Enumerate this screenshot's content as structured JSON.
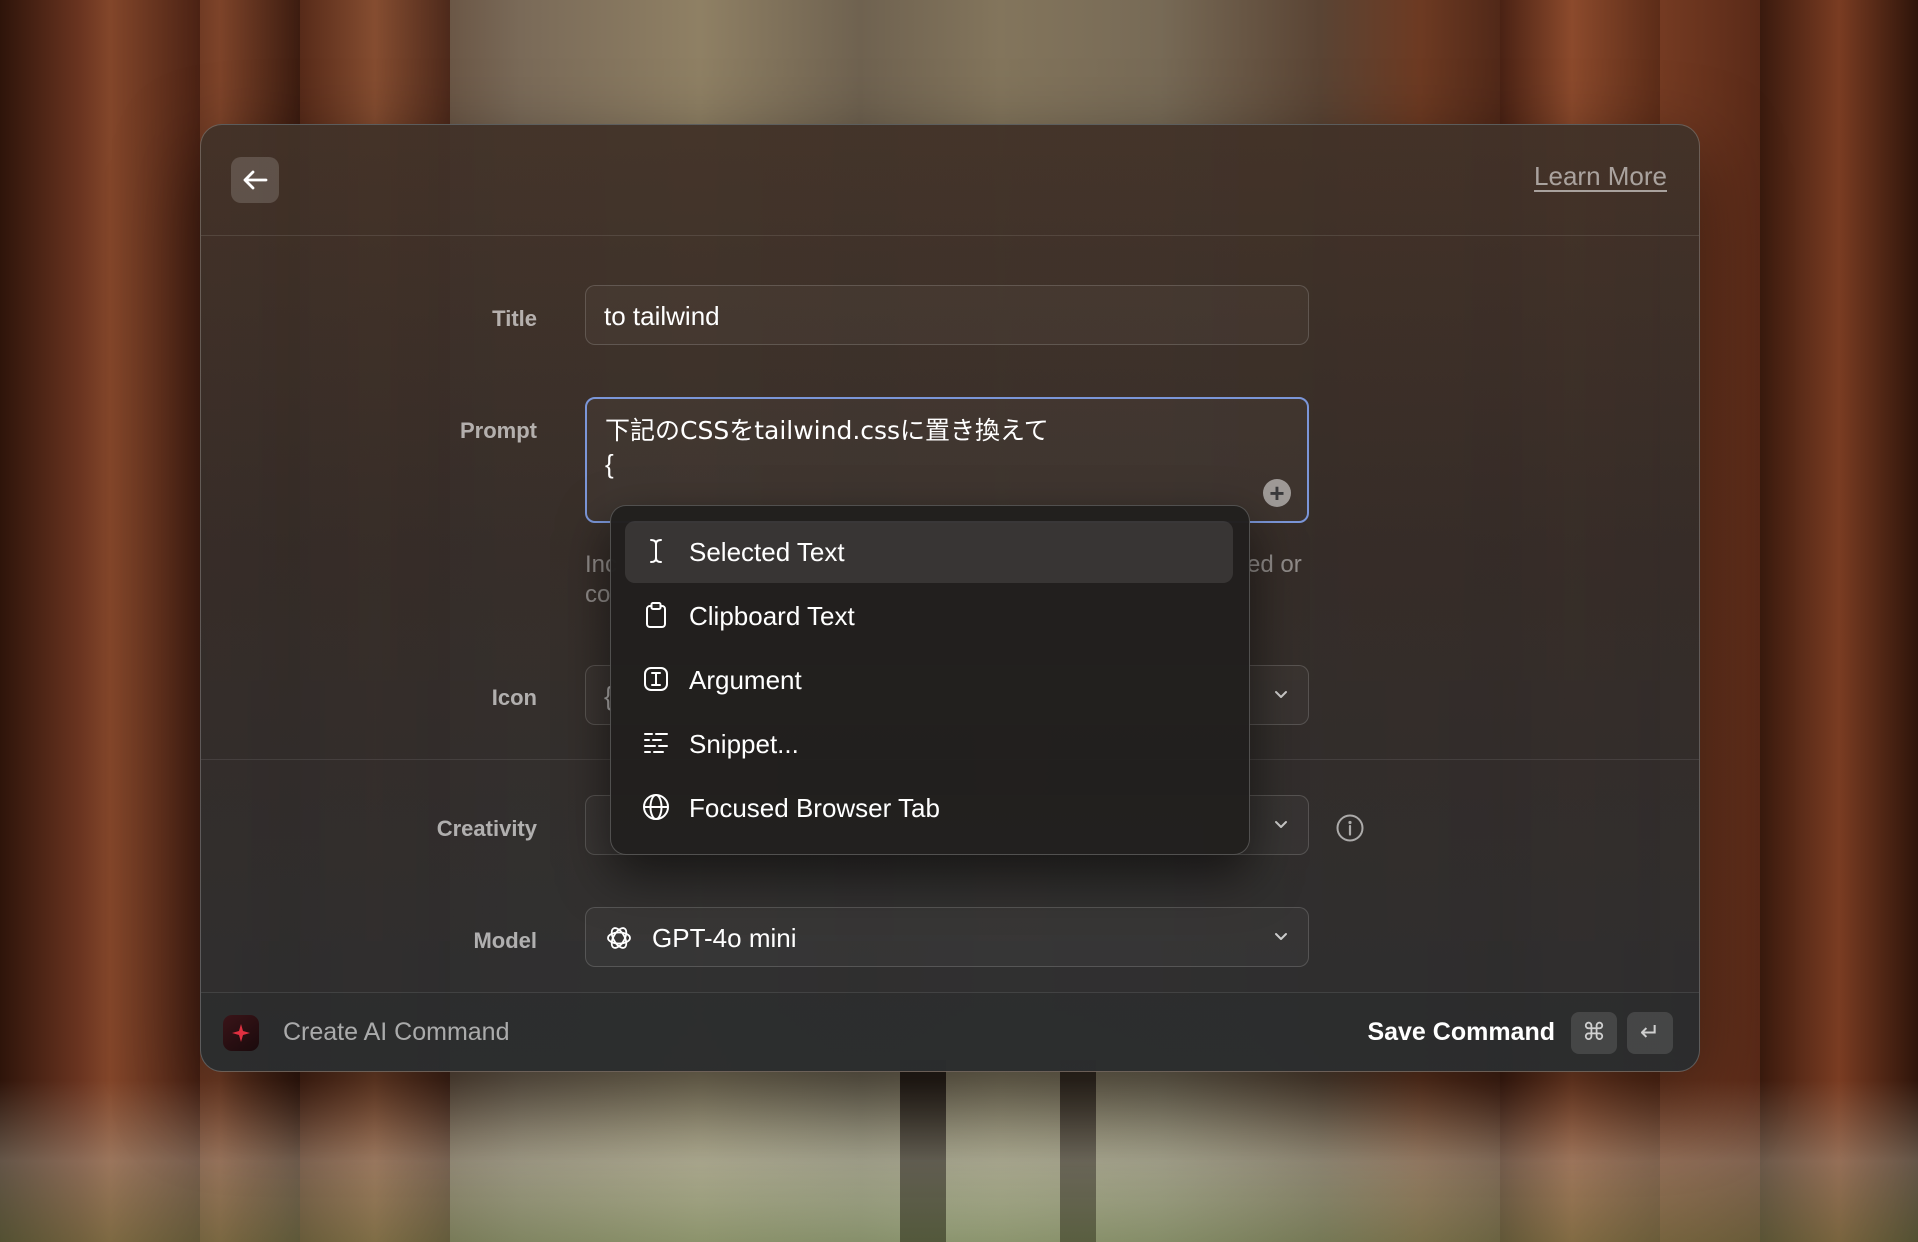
{
  "window": {
    "learn_more": "Learn More"
  },
  "form": {
    "title_label": "Title",
    "title_value": "to tailwind",
    "prompt_label": "Prompt",
    "prompt_line1": "下記のCSSをtailwind.cssに置き換えて",
    "prompt_line2": "{",
    "hint_left_1": "Inc",
    "hint_left_2": "co",
    "hint_right_1": "ed or",
    "icon_label": "Icon",
    "icon_value_partial": "{",
    "creativity_label": "Creativity",
    "creativity_value_partial": "",
    "model_label": "Model",
    "model_value": "GPT-4o mini"
  },
  "dropdown": {
    "items": [
      {
        "label": "Selected Text",
        "icon": "text-cursor-icon",
        "selected": true
      },
      {
        "label": "Clipboard Text",
        "icon": "clipboard-icon",
        "selected": false
      },
      {
        "label": "Argument",
        "icon": "argument-icon",
        "selected": false
      },
      {
        "label": "Snippet...",
        "icon": "snippet-icon",
        "selected": false
      },
      {
        "label": "Focused Browser Tab",
        "icon": "globe-icon",
        "selected": false
      }
    ]
  },
  "footer": {
    "title": "Create AI Command",
    "save_label": "Save Command",
    "shortcut_cmd": "⌘",
    "shortcut_enter": "↵"
  },
  "colors": {
    "focus_border": "#7b96d8",
    "app_icon_accent": "#e03040"
  }
}
